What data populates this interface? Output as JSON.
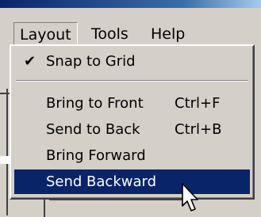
{
  "menubar": {
    "items": [
      {
        "label": "Layout",
        "active": true
      },
      {
        "label": "Tools"
      },
      {
        "label": "Help"
      }
    ]
  },
  "dropdown": {
    "items": [
      {
        "label": "Snap to Grid",
        "checked": true,
        "shortcut": ""
      },
      {
        "label": "Bring to Front",
        "shortcut": "Ctrl+F"
      },
      {
        "label": "Send to Back",
        "shortcut": "Ctrl+B"
      },
      {
        "label": "Bring Forward",
        "shortcut": ""
      },
      {
        "label": "Send Backward",
        "shortcut": "",
        "highlighted": true
      }
    ]
  },
  "colors": {
    "menu_bg": "#d4d0c8",
    "highlight": "#0a246a",
    "highlight_text": "#ffffff"
  },
  "icons": {
    "check": "checkmark-icon",
    "cursor": "mouse-pointer-icon"
  }
}
